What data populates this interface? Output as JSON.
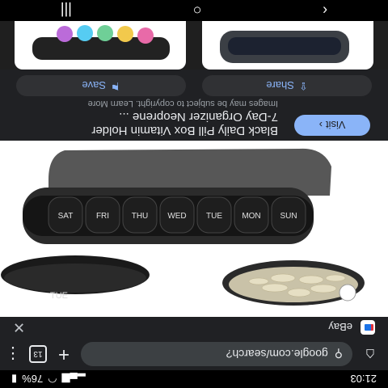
{
  "status_bar": {
    "time": "21:03",
    "battery": "76%"
  },
  "browser": {
    "url": "google.com/search?",
    "tab_count": "13",
    "home_icon": "home-icon",
    "new_tab_icon": "plus-icon",
    "menu_icon": "kebab-menu-icon"
  },
  "source": {
    "site": "eBay"
  },
  "image": {
    "pill_days": [
      "SUN",
      "MON",
      "TUE",
      "WED",
      "THU",
      "FRI",
      "SAT"
    ],
    "loose_lid_label": "TUE"
  },
  "info": {
    "visit_label": "Visit",
    "title_line1": "Black Daily Pill Box Vitamin Holder",
    "title_line2": "7-Day Organizer Neoprene ...",
    "copyright": "Images may be subject to copyright. Learn More",
    "share_label": "Share",
    "save_label": "Save"
  },
  "nav": {
    "recents_icon": "recents-icon",
    "home_icon": "home-circle-icon",
    "back_icon": "back-chevron-icon"
  },
  "colors": {
    "accent": "#8ab4f8",
    "panel": "#202124",
    "button": "#303134"
  }
}
